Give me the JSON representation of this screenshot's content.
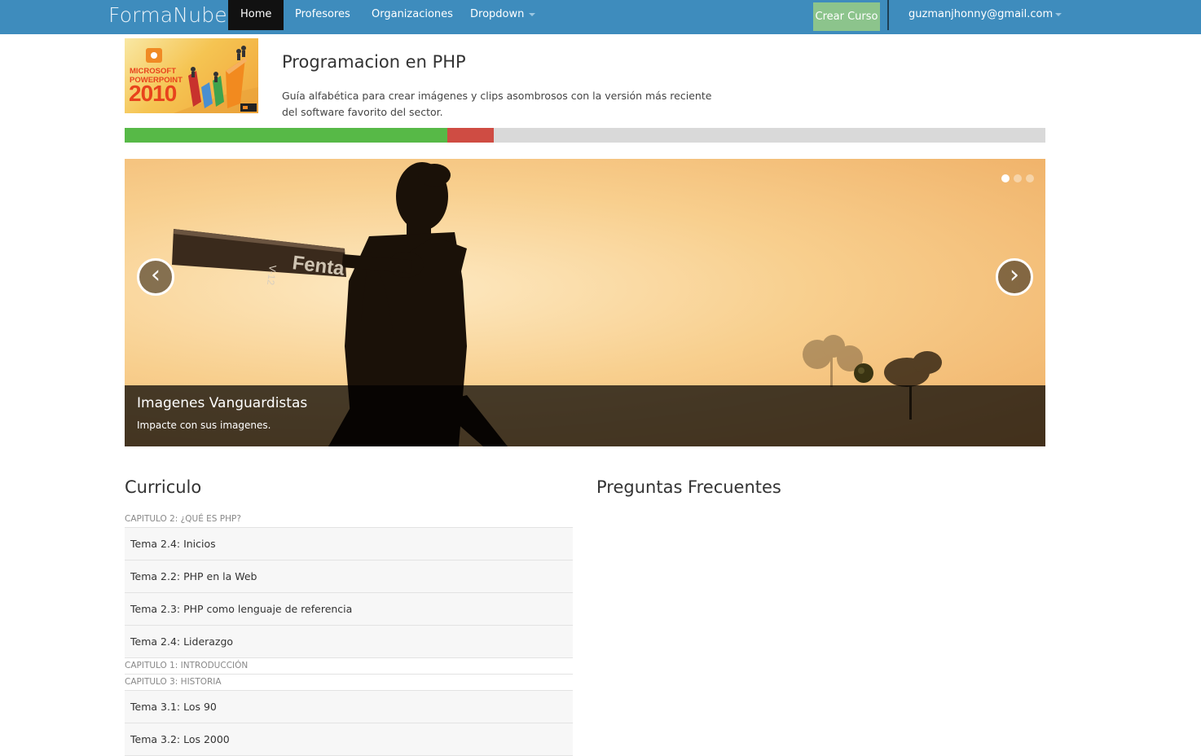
{
  "navbar": {
    "brand": "FormaNube",
    "items": [
      {
        "label": "Home",
        "active": true
      },
      {
        "label": "Profesores"
      },
      {
        "label": "Organizaciones"
      },
      {
        "label": "Dropdown"
      }
    ],
    "create_button": "Crear Curso",
    "user_email": "guzmanjhonny@gmail.com",
    "colors": {
      "bar": "#3e8cbd",
      "active": "#111111",
      "create": "#8cc48c"
    }
  },
  "course": {
    "thumbnail": {
      "line1": "MICROSOFT",
      "line2": "POWERPOINT",
      "year": "2010"
    },
    "title": "Programacion en PHP",
    "description": "Guía alfabética para crear imágenes y clips asombrosos con la versión más reciente del software favorito del sector.",
    "progress": {
      "completed": 0.35,
      "failed": 0.05,
      "colors": {
        "completed": "#57b947",
        "failed": "#cf4c43",
        "remaining": "#d9d9d9"
      }
    }
  },
  "carousel": {
    "slide_count": 3,
    "active_index": 0,
    "caption_title": "Imagenes Vanguardistas",
    "caption_text": "Impacte con sus imagenes.",
    "prev_glyph": "‹",
    "next_glyph": "›",
    "bat_text": "Fenta",
    "bat_model": "V-12"
  },
  "curriculum": {
    "title": "Curriculo",
    "chapters": [
      {
        "title": "Capitulo 2: ¿Qué es PHP?",
        "topics": [
          "Tema 2.4: Inicios",
          "Tema 2.2: PHP en la Web",
          "Tema 2.3: PHP como lenguaje de referencia",
          "Tema 2.4: Liderazgo"
        ]
      },
      {
        "title": "Capitulo 1: Introducción",
        "topics": []
      },
      {
        "title": "Capitulo 3: Historia",
        "topics": [
          "Tema 3.1: Los 90",
          "Tema 3.2: Los 2000"
        ]
      }
    ]
  },
  "faq": {
    "title": "Preguntas Frecuentes"
  }
}
